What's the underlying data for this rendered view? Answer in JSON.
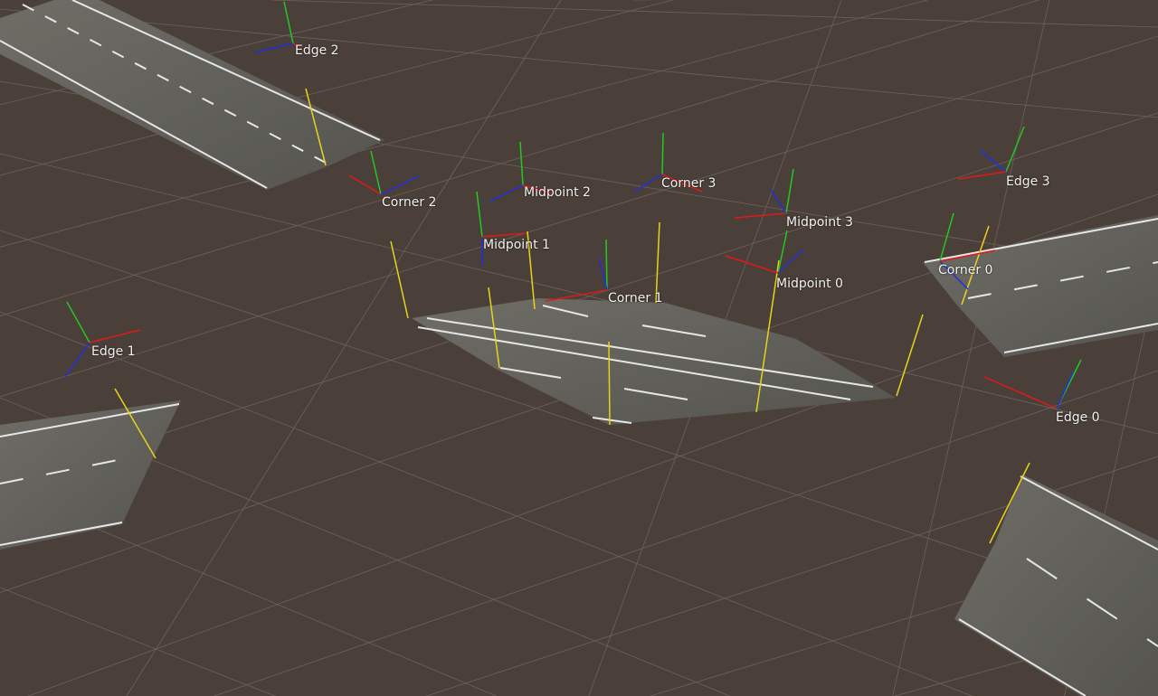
{
  "scene": {
    "background": "#4a3f38",
    "grid_color": "#8a7f78",
    "road_color": "#6a6a63",
    "road_marking_color": "#e6e6e6",
    "axis_colors": {
      "x": "#e01919",
      "y": "#22c722",
      "z": "#1f2fe0",
      "guide": "#e8d21a"
    }
  },
  "markers": [
    {
      "label": "Edge 2"
    },
    {
      "label": "Corner 2"
    },
    {
      "label": "Midpoint 2"
    },
    {
      "label": "Corner 3"
    },
    {
      "label": "Midpoint 1"
    },
    {
      "label": "Midpoint 3"
    },
    {
      "label": "Edge 3"
    },
    {
      "label": "Corner 0"
    },
    {
      "label": "Corner 1"
    },
    {
      "label": "Midpoint 0"
    },
    {
      "label": "Edge 1"
    },
    {
      "label": "Edge 0"
    }
  ]
}
